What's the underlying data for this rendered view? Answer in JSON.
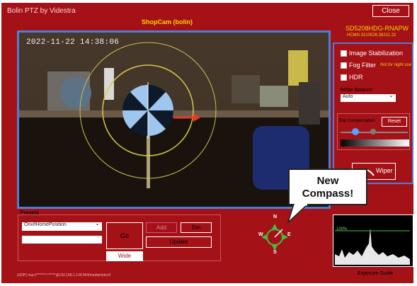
{
  "window": {
    "title": "Bolin PTZ by Videstra",
    "close_label": "Close"
  },
  "camera": {
    "name": "ShopCam (bolin)",
    "model": "SD5208HDG-RNAPW",
    "model_sub": "HCMN 3210528.38211 22"
  },
  "video": {
    "timestamp": "2022-11-22 14:38:06"
  },
  "settings": {
    "image_stabilization": "Image Stabilization",
    "fog_filter": "Fog Filter",
    "fog_note": "Not for night use",
    "hdr": "HDR",
    "white_balance_label": "White Balance",
    "white_balance_value": "Auto",
    "exp_comp_label": "Exp Compensation",
    "reset_label": "Reset",
    "exp_comp_level": 0.25,
    "wiper_label": "Wiper"
  },
  "presets": {
    "label": "Presets",
    "selected": "OnvifHomePosition",
    "go_label": "Go",
    "add_label": "Add",
    "del_label": "Del",
    "update_label": "Update",
    "wide_label": "Wide"
  },
  "compass": {
    "n": "N",
    "s": "S",
    "e": "E",
    "w": "W"
  },
  "callout": {
    "line1": "New",
    "line2": "Compass!"
  },
  "exposure": {
    "label": "Exposure Guide",
    "top_marker": "100%"
  },
  "stream_url": "(UDP) rtsp://*******:******@192.168.1.135:554/media/video2",
  "colors": {
    "background": "#a41217",
    "accent": "#4a7fd6",
    "highlight": "#ffd200"
  }
}
